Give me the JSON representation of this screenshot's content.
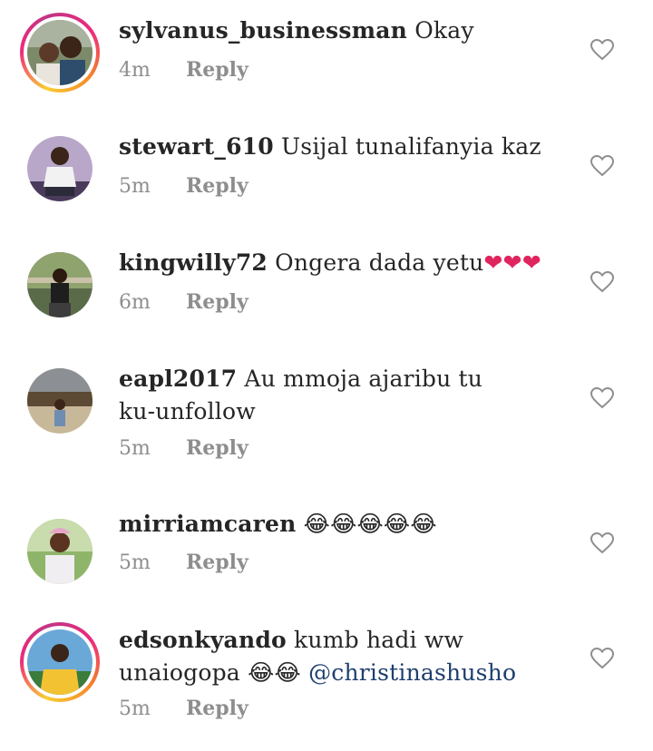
{
  "comments": [
    {
      "username": "sylvanus_businessman",
      "text": "Okay",
      "time": "4m",
      "reply": "Reply",
      "story_ring": true
    },
    {
      "username": "stewart_610",
      "text": "Usijal tunalifanyia kaz",
      "time": "5m",
      "reply": "Reply",
      "story_ring": false
    },
    {
      "username": "kingwilly72",
      "text": "Ongera dada yetu",
      "emoji": "❤❤❤",
      "time": "6m",
      "reply": "Reply",
      "story_ring": false
    },
    {
      "username": "eapl2017",
      "text_line1": "Au mmoja ajaribu tu",
      "text_line2": "ku-unfollow",
      "time": "5m",
      "reply": "Reply",
      "story_ring": false
    },
    {
      "username": "mirriamcaren",
      "emoji": "😂😂😂😂😂",
      "time": "5m",
      "reply": "Reply",
      "story_ring": false
    },
    {
      "username": "edsonkyando",
      "text_line1": "kumb hadi ww",
      "text_line2": "unaiogopa",
      "emoji": "😂😂",
      "mention": "@christinashusho",
      "time": "5m",
      "reply": "Reply",
      "story_ring": true
    }
  ],
  "icons": {
    "like": "heart-outline-icon",
    "like_color": "#8e8e8e"
  },
  "colors": {
    "username": "#262626",
    "meta": "#8e8e8e",
    "mention": "#1f3f6e",
    "ring_start": "#f9ce34",
    "ring_mid": "#ee2a7b"
  }
}
